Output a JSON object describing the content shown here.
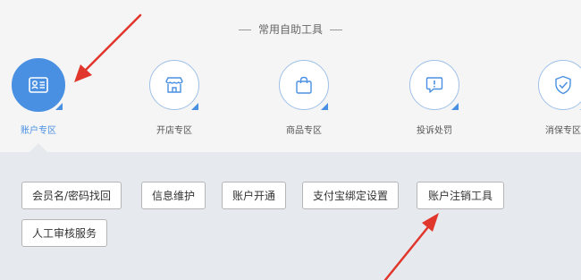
{
  "section_title": "常用自助工具",
  "zones": [
    {
      "label": "账户专区",
      "icon": "id-card-icon",
      "active": true
    },
    {
      "label": "开店专区",
      "icon": "storefront-icon",
      "active": false
    },
    {
      "label": "商品专区",
      "icon": "shopping-bag-icon",
      "active": false
    },
    {
      "label": "投诉处罚",
      "icon": "complaint-bubble-icon",
      "active": false
    },
    {
      "label": "消保专区",
      "icon": "shield-check-icon",
      "active": false
    }
  ],
  "tools": [
    "会员名/密码找回",
    "信息维护",
    "账户开通",
    "支付宝绑定设置",
    "账户注销工具",
    "人工审核服务"
  ],
  "colors": {
    "accent": "#4a90e2",
    "annotation_arrow": "#e0362c"
  }
}
